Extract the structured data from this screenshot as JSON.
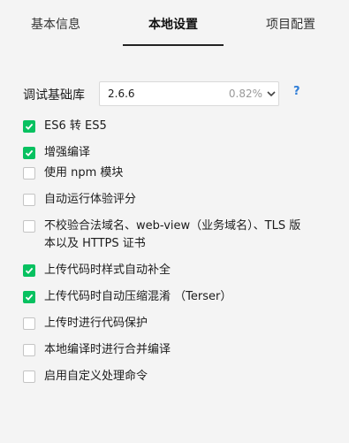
{
  "tabs": [
    {
      "label": "基本信息",
      "active": false
    },
    {
      "label": "本地设置",
      "active": true
    },
    {
      "label": "项目配置",
      "active": false
    }
  ],
  "debug_lib": {
    "label": "调试基础库",
    "value": "2.6.6",
    "percent": "0.82%",
    "help": "?"
  },
  "options": [
    {
      "label": "ES6 转 ES5",
      "checked": true
    },
    {
      "label": "增强编译",
      "checked": true
    },
    {
      "label": "使用 npm 模块",
      "checked": false
    },
    {
      "label": "自动运行体验评分",
      "checked": false
    },
    {
      "label": "不校验合法域名、web-view（业务域名）、TLS 版本以及 HTTPS 证书",
      "checked": false
    },
    {
      "label": "上传代码时样式自动补全",
      "checked": true
    },
    {
      "label": "上传代码时自动压缩混淆 （Terser）",
      "checked": true
    },
    {
      "label": "上传时进行代码保护",
      "checked": false
    },
    {
      "label": "本地编译时进行合并编译",
      "checked": false
    },
    {
      "label": "启用自定义处理命令",
      "checked": false
    }
  ],
  "colors": {
    "accent": "#07c160",
    "help": "#2f7dd7"
  }
}
